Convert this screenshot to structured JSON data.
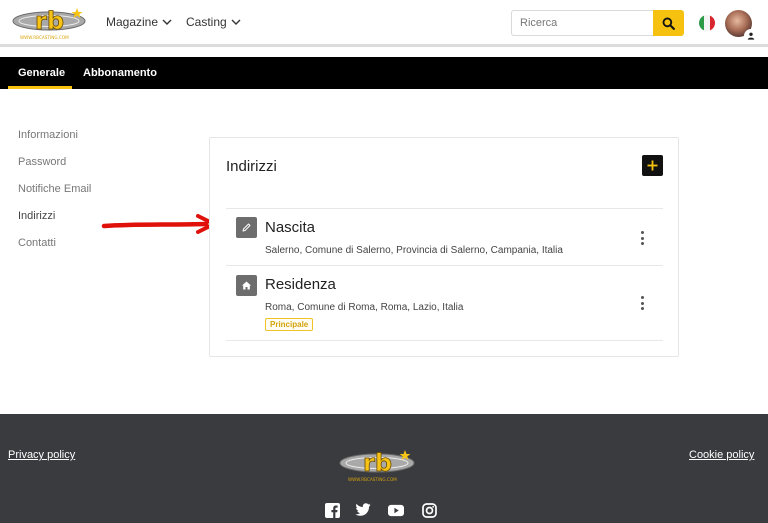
{
  "header": {
    "logo_text": "rb",
    "logo_tagline": "WWW.RBCASTING.COM",
    "nav": [
      {
        "label": "Magazine"
      },
      {
        "label": "Casting"
      }
    ],
    "search": {
      "placeholder": "Ricerca",
      "value": ""
    },
    "language": "Italiano",
    "icons": [
      "search-icon",
      "italy-flag-icon",
      "user-avatar",
      "user-icon"
    ]
  },
  "tabs": [
    {
      "label": "Generale",
      "active": true
    },
    {
      "label": "Abbonamento",
      "active": false
    }
  ],
  "sidebar": {
    "items": [
      {
        "label": "Informazioni",
        "active": false
      },
      {
        "label": "Password",
        "active": false
      },
      {
        "label": "Notifiche Email",
        "active": false
      },
      {
        "label": "Indirizzi",
        "active": true
      },
      {
        "label": "Contatti",
        "active": false
      }
    ]
  },
  "addresses": {
    "title": "Indirizzi",
    "items": [
      {
        "type": "Nascita",
        "icon": "pencil-icon",
        "address": "Salerno, Comune di Salerno, Provincia di Salerno, Campania, Italia",
        "badge": ""
      },
      {
        "type": "Residenza",
        "icon": "home-icon",
        "address": "Roma, Comune di Roma, Roma, Lazio, Italia",
        "badge": "Principale"
      }
    ]
  },
  "footer": {
    "privacy": "Privacy policy",
    "cookie": "Cookie policy",
    "social": [
      "facebook-icon",
      "twitter-icon",
      "youtube-icon",
      "instagram-icon"
    ]
  },
  "colors": {
    "accent": "#f7c20f",
    "tabbar": "#000000",
    "footer": "#3a3b3f",
    "arrow": "#e0100b",
    "icon_bg": "#6d6d6d"
  }
}
